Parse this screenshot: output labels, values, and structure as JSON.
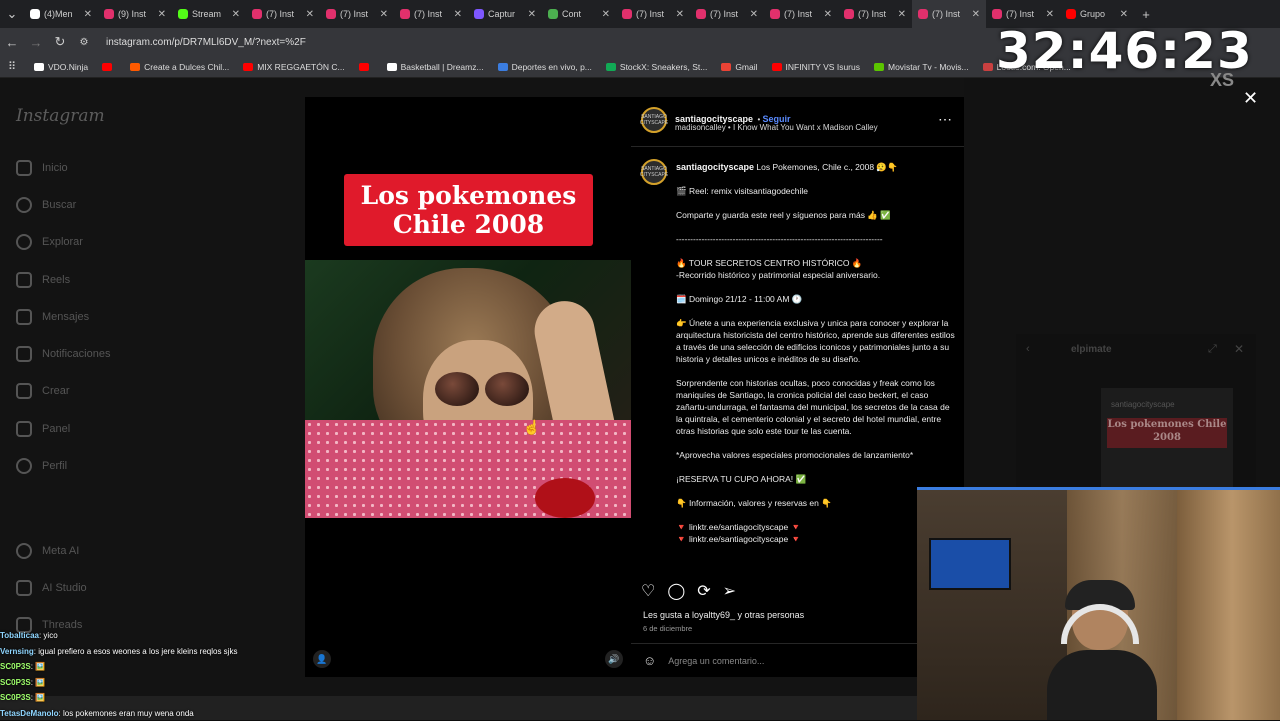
{
  "browser": {
    "tabs": [
      {
        "label": "(4)Men",
        "color": "#ffffff"
      },
      {
        "label": "(9) Inst",
        "color": "#e1306c"
      },
      {
        "label": "Stream",
        "color": "#53fc18"
      },
      {
        "label": "(7) Inst",
        "color": "#e1306c"
      },
      {
        "label": "(7) Inst",
        "color": "#e1306c"
      },
      {
        "label": "(7) Inst",
        "color": "#e1306c"
      },
      {
        "label": "Captur",
        "color": "#7e57ff"
      },
      {
        "label": "Cont",
        "color": "#4caf50"
      },
      {
        "label": "(7) Inst",
        "color": "#e1306c"
      },
      {
        "label": "(7) Inst",
        "color": "#e1306c"
      },
      {
        "label": "(7) Inst",
        "color": "#e1306c"
      },
      {
        "label": "(7) Inst",
        "color": "#e1306c"
      },
      {
        "label": "(7) Inst",
        "color": "#e1306c"
      },
      {
        "label": "(7) Inst",
        "color": "#e1306c"
      },
      {
        "label": "Grupo",
        "color": "#ff0000"
      }
    ],
    "url": "instagram.com/p/DR7MLl6DV_M/?next=%2F",
    "bookmarks": [
      {
        "label": "VDO.Ninja",
        "color": "#ffffff"
      },
      {
        "label": "",
        "color": "#ff0000"
      },
      {
        "label": "Create a Dulces Chil...",
        "color": "#ff5a00"
      },
      {
        "label": "MIX REGGAETÓN C...",
        "color": "#ff0000"
      },
      {
        "label": "",
        "color": "#ff0000"
      },
      {
        "label": "Basketball | Dreamz...",
        "color": "#ffffff"
      },
      {
        "label": "Deportes en vivo, p...",
        "color": "#3b7de0"
      },
      {
        "label": "StockX: Sneakers, St...",
        "color": "#11aa55"
      },
      {
        "label": "Gmail",
        "color": "#ea4335"
      },
      {
        "label": "INFINITY VS Isurus",
        "color": "#ff0000"
      },
      {
        "label": "Movistar Tv - Movis...",
        "color": "#5bc500"
      },
      {
        "label": "Lootie.com: Open...",
        "color": "#c94040"
      }
    ]
  },
  "timer": {
    "value": "32:46:23",
    "sub": "XS"
  },
  "instagram": {
    "logo": "Instagram",
    "nav": [
      "Inicio",
      "Buscar",
      "Explorar",
      "Reels",
      "Mensajes",
      "Notificaciones",
      "Crear",
      "Panel",
      "Perfil",
      "Meta AI",
      "AI Studio",
      "Threads"
    ],
    "post": {
      "video_title_line1": "Los pokemones",
      "video_title_line2": "Chile 2008",
      "author": "santiagocityscape",
      "avatar_text": "SANTIAGO CITYSCAPE",
      "follow": "Seguir",
      "audio": "madisoncalley • I Know What You Want x Madison Calley",
      "caption_title": "Los Pokemones, Chile c., 2008 😮‍💨👇",
      "caption": [
        "🎬 Reel: remix visitsantiagodechile",
        "Comparte y guarda este reel y síguenos para más 👍 ✅",
        "-------------------------------------------------------------------------",
        "🔥 TOUR SECRETOS CENTRO HISTÓRICO 🔥\n-Recorrido histórico y patrimonial especial aniversario.",
        "🗓️ Domingo 21/12 - 11:00 AM 🕐",
        "👉 Únete a una experiencia exclusiva y unica para conocer y explorar la arquitectura historicista del centro histórico, aprende sus diferentes estilos a través de una selección de edificios iconicos y patrimoniales junto a su historia y detalles unicos e inéditos de su diseño.",
        "Sorprendente con historias ocultas, poco conocidas y freak como los maniquíes de Santiago, la cronica policial del caso beckert, el caso zañartu-undurraga, el fantasma del municipal, los secretos de la casa de la quintrala, el cementerio colonial y el secreto del hotel mundial, entre otras historias que solo este tour te las cuenta.",
        "*Aprovecha valores especiales promocionales de lanzamiento*",
        "¡RESERVA TU CUPO AHORA! ✅",
        "👇 Información, valores y reservas en 👇",
        "🔻 linktr.ee/santiagocityscape 🔻\n🔻 linktr.ee/santiagocityscape 🔻"
      ],
      "likes": "Les gusta a loyaltty69_ y otras personas",
      "date": "6 de diciembre",
      "comment_placeholder": "Agrega un comentario..."
    },
    "mini_player": {
      "title": "elpimate",
      "card_user": "santiagocityscape",
      "card_title": "Los pokemones Chile 2008"
    }
  },
  "chat": [
    {
      "user": "Tobalticaa",
      "msg": ": yico"
    },
    {
      "user": "Vernsing",
      "msg": ": igual prefiero a esos weones a los jere kleins reqlos sjks"
    },
    {
      "user": "SC0P3S",
      "msg": ": 🖼️"
    },
    {
      "user": "SC0P3S",
      "msg": ": 🖼️"
    },
    {
      "user": "SC0P3S",
      "msg": ": 🖼️"
    },
    {
      "user": "TetasDeManolo",
      "msg": ": los pokemones eran muy wena onda"
    }
  ]
}
